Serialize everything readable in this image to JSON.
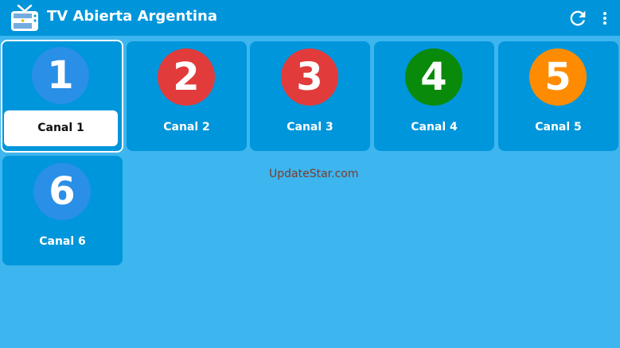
{
  "appbar": {
    "title": "TV Abierta Argentina",
    "app_icon": "tv-flag-icon",
    "actions": [
      {
        "icon": "refresh-icon"
      },
      {
        "icon": "more-vert-icon"
      }
    ]
  },
  "channels": [
    {
      "number": "1",
      "label": "Canal 1",
      "color": "#2a8fe6",
      "selected": true
    },
    {
      "number": "2",
      "label": "Canal 2",
      "color": "#e23b3b"
    },
    {
      "number": "3",
      "label": "Canal 3",
      "color": "#e23b3b"
    },
    {
      "number": "4",
      "label": "Canal 4",
      "color": "#0a8a0a"
    },
    {
      "number": "5",
      "label": "Canal 5",
      "color": "#ff8c00"
    },
    {
      "number": "6",
      "label": "Canal 6",
      "color": "#2a8fe6"
    }
  ],
  "watermark": "UpdateStar.com",
  "colors": {
    "appbar": "#0095da",
    "background": "#3db5ee",
    "tile": "#0096db"
  }
}
